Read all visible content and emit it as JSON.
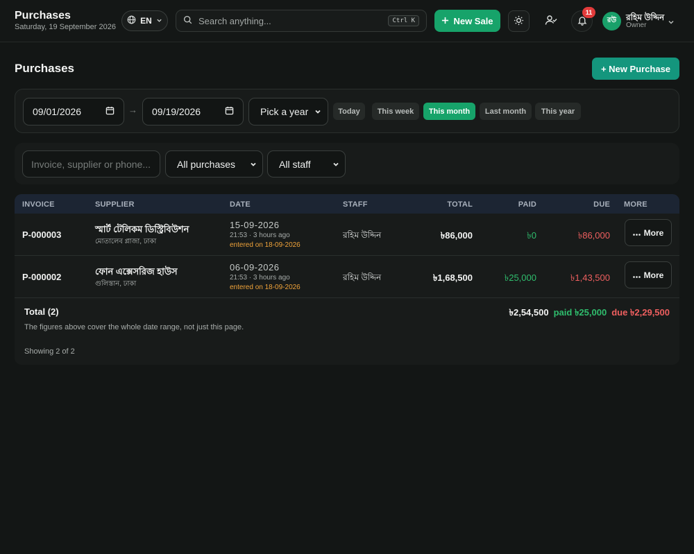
{
  "header": {
    "title": "Purchases",
    "date": "Saturday, 19 September 2026",
    "language": "EN",
    "search_placeholder": "Search anything...",
    "search_shortcut": "Ctrl K",
    "new_sale_label": "New Sale",
    "notification_count": "11",
    "user": {
      "initials": "রউ",
      "name": "রহিম উদ্দিন",
      "role": "Owner"
    }
  },
  "page": {
    "title": "Purchases",
    "new_purchase_label": "+ New Purchase"
  },
  "date_filter": {
    "from": "09/01/2026",
    "to": "09/19/2026",
    "arrow": "→",
    "year_select": "Pick a year",
    "chips": [
      "Today",
      "This week",
      "This month",
      "Last month",
      "This year"
    ],
    "active_chip": "This month"
  },
  "filters": {
    "search_placeholder": "Invoice, supplier or phone...",
    "type_select": "All purchases",
    "staff_select": "All staff"
  },
  "table": {
    "columns": [
      "INVOICE",
      "SUPPLIER",
      "DATE",
      "STAFF",
      "TOTAL",
      "PAID",
      "DUE",
      "MORE"
    ],
    "rows": [
      {
        "invoice": "P-000003",
        "supplier": "স্মার্ট টেলিকম ডিস্ট্রিবিউশন",
        "address": "মোতালেব প্লাজা, ঢাকা",
        "date": "15-09-2026",
        "time_ago": "21:53 · 3 hours ago",
        "entered": "entered on 18-09-2026",
        "staff": "রহিম উদ্দিন",
        "total": "৳86,000",
        "paid": "৳0",
        "due": "৳86,000",
        "more_label": "More"
      },
      {
        "invoice": "P-000002",
        "supplier": "ফোন এক্সেসরিজ হাউস",
        "address": "গুলিস্তান, ঢাকা",
        "date": "06-09-2026",
        "time_ago": "21:53 · 3 hours ago",
        "entered": "entered on 18-09-2026",
        "staff": "রহিম উদ্দিন",
        "total": "৳1,68,500",
        "paid": "৳25,000",
        "due": "৳1,43,500",
        "more_label": "More"
      }
    ],
    "total_label": "Total (2)",
    "total_amount": "৳2,54,500",
    "total_paid": "paid ৳25,000",
    "total_due": "due ৳2,29,500",
    "note": "The figures above cover the whole date range, not just this page.",
    "showing": "Showing 2 of 2"
  },
  "colors": {
    "accent_green": "#17a36a",
    "teal": "#14967d",
    "paid_green": "#2fbd6d",
    "due_red": "#ee5f5f",
    "entered_orange": "#f0a33a"
  }
}
